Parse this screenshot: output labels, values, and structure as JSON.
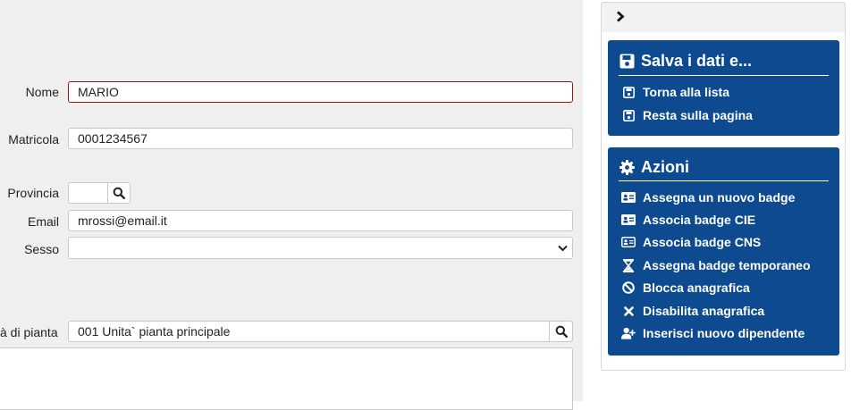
{
  "form": {
    "nome": {
      "label": "Nome",
      "value": "MARIO"
    },
    "matricola": {
      "label": "Matricola",
      "value": "0001234567"
    },
    "provincia": {
      "label": "Provincia",
      "value": ""
    },
    "email": {
      "label": "Email",
      "value": "mrossi@email.it"
    },
    "sesso": {
      "label": "Sesso",
      "value": ""
    },
    "unita": {
      "label": "à di pianta",
      "value": "001 Unita` pianta principale"
    }
  },
  "sidebar": {
    "collapse_icon": "chevron-right-icon",
    "save_panel": {
      "title": "Salva i dati e...",
      "title_icon": "floppy-disk-icon",
      "items": [
        {
          "label": "Torna alla lista",
          "icon": "floppy-small-icon"
        },
        {
          "label": "Resta sulla pagina",
          "icon": "floppy-small-icon"
        }
      ]
    },
    "actions_panel": {
      "title": "Azioni",
      "title_icon": "gear-icon",
      "items": [
        {
          "label": "Assegna un nuovo badge",
          "icon": "id-card-icon"
        },
        {
          "label": "Associa badge CIE",
          "icon": "id-card-icon"
        },
        {
          "label": "Associa badge CNS",
          "icon": "id-card-outline-icon"
        },
        {
          "label": "Assegna badge temporaneo",
          "icon": "hourglass-icon"
        },
        {
          "label": "Blocca anagrafica",
          "icon": "ban-icon"
        },
        {
          "label": "Disabilita anagrafica",
          "icon": "times-icon"
        },
        {
          "label": "Inserisci nuovo dipendente",
          "icon": "user-plus-icon"
        }
      ]
    }
  },
  "colors": {
    "panel_bg": "#0e4a8f",
    "form_bg": "#efefef",
    "error_border": "#8b1a1a"
  }
}
